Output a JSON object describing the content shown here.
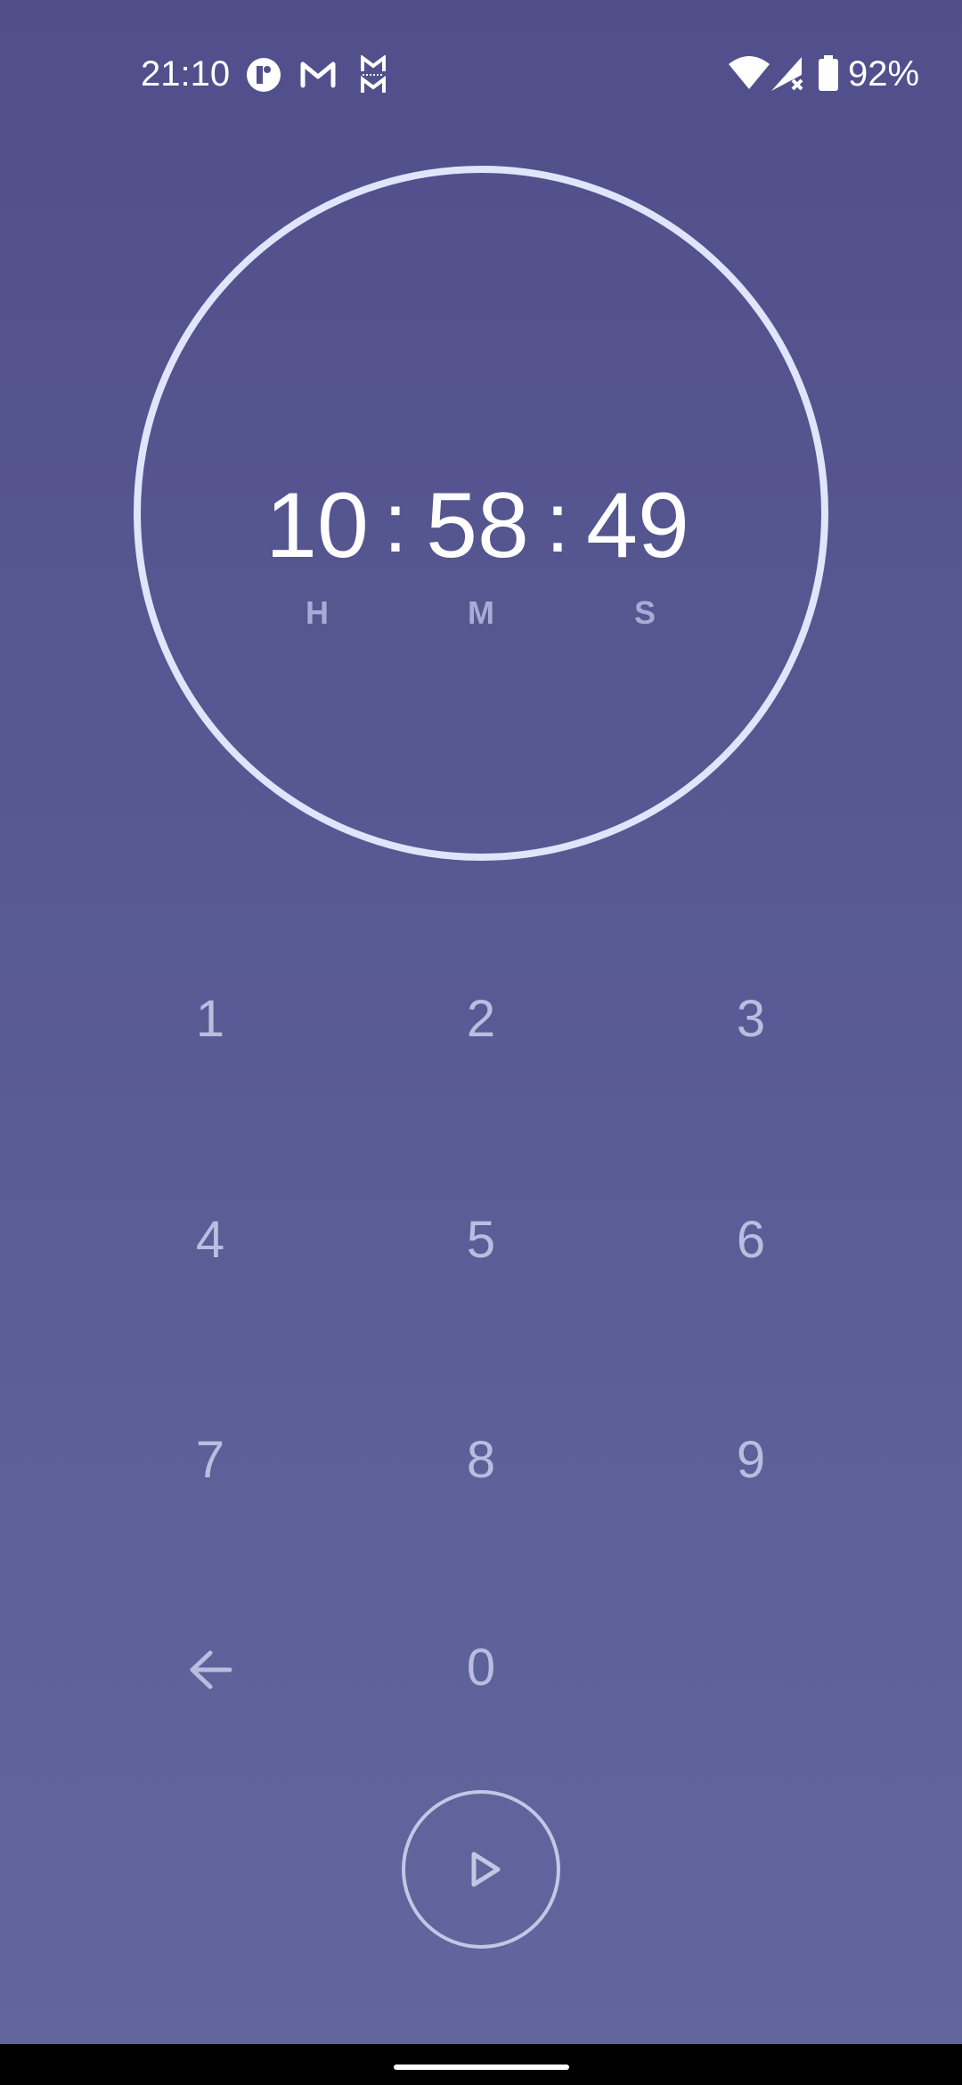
{
  "status_bar": {
    "time": "21:10",
    "battery_percent": "92%",
    "icons": [
      "notification-app-icon",
      "gmail-icon",
      "messaging-app-icon",
      "wifi-icon",
      "cell-signal-icon",
      "battery-icon"
    ]
  },
  "timer": {
    "hours": "10",
    "minutes": "58",
    "seconds": "49",
    "separator": ":",
    "unit_hours": "H",
    "unit_minutes": "M",
    "unit_seconds": "S"
  },
  "keypad": {
    "k1": "1",
    "k2": "2",
    "k3": "3",
    "k4": "4",
    "k5": "5",
    "k6": "6",
    "k7": "7",
    "k8": "8",
    "k9": "9",
    "k0": "0",
    "backspace_icon": "backspace-arrow-icon"
  },
  "controls": {
    "start_icon": "play-icon"
  },
  "colors": {
    "background_top": "#514f8b",
    "background_bottom": "#62669e",
    "ring": "#dfe6fb",
    "key_text": "#b9bde0",
    "unit_label": "#a8acd5"
  }
}
